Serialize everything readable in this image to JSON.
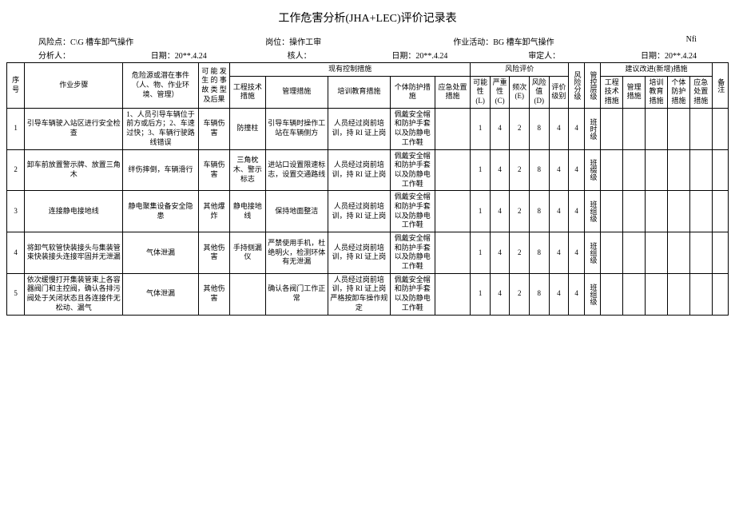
{
  "title": "工作危害分析(JHA+LEC)评价记录表",
  "meta": {
    "l1a": "风险点：C\\G 槽车卸气操作",
    "l1b": "岗位：操作工审",
    "l1c": "作业活动：BG 槽车卸气操作",
    "l1d": "Nfi",
    "l2a": "分析人：",
    "l2b": "日期：20**.4.24",
    "l2c": "核人：",
    "l2d": "日期：20**.4.24",
    "l2e": "审定人：",
    "l2f": "日期：20**.4.24"
  },
  "hdr": {
    "seq": "序号",
    "step": "作业步骤",
    "hazard": "危险源或潜在事件（人、物、作业环境、管理）",
    "acc": "可 能 发生 的 事故 类 型及后果",
    "ctrl": "现有控制措施",
    "eng": "工程技术措施",
    "mgt": "管理措施",
    "trn": "培训教育措施",
    "ppe": "个体防护措施",
    "emg": "应急处置措施",
    "risk": "风险评价",
    "l": "可能性(L)",
    "c": "严重性(C)",
    "e": "频次(E)",
    "d": "风险值(D)",
    "lv": "评价级别",
    "rl": "风险分级",
    "cl": "管控层级",
    "sug": "建议改进(新增)措施",
    "se": "工程技术措施",
    "sm": "管理措施",
    "st": "培训教育措施",
    "sp": "个体防护措施",
    "sa": "应急处置措施",
    "rm": "备注"
  },
  "rows": [
    {
      "n": "1",
      "step": "引导车辆驶入站区进行安全检查",
      "haz": "1、人员引导车辆位于前方或后方；2、车速过快；3、车辆行驶路线错误",
      "acc": "车辆伤害",
      "eng": "防撞柱",
      "mgt": "引导车辆时操作工站在车辆侧方",
      "trn": "人员经过岗前培训，持 RI 证上岗",
      "ppe": "佩戴安全帽和防护手套以及防静电工作鞋",
      "emg": "",
      "l": "1",
      "c": "4",
      "e": "2",
      "d": "8",
      "lv": "4",
      "rl": "4",
      "cl": "班时级"
    },
    {
      "n": "2",
      "step": "卸车前放置警示牌、放置三角木",
      "haz": "绊伤摔倒，车辆滑行",
      "acc": "车辆伤害",
      "eng": "三角枕木、警示标志",
      "mgt": "进站口设置限速标志，设置交通路线",
      "trn": "人员经过岗前培训，持 RI 证上岗",
      "ppe": "佩戴安全帽和防护手套以及防静电工作鞋",
      "emg": "",
      "l": "1",
      "c": "4",
      "e": "2",
      "d": "8",
      "lv": "4",
      "rl": "4",
      "cl": "班缀级"
    },
    {
      "n": "3",
      "step": "连接静电接地线",
      "haz": "静电聚集设备安全隐患",
      "acc": "其他爆炸",
      "eng": "静电接地线",
      "mgt": "保持地面整洁",
      "trn": "人员经过岗前培训，持 RI 证上岗",
      "ppe": "佩戴安全帽和防护手套以及防静电工作鞋",
      "emg": "",
      "l": "1",
      "c": "4",
      "e": "2",
      "d": "8",
      "lv": "4",
      "rl": "4",
      "cl": "班组级"
    },
    {
      "n": "4",
      "step": "将卸气软管快装接头与集装管束快装接头连接牢固并无泄漏",
      "haz": "气体泄漏",
      "acc": "其他伤害",
      "eng": "手持侧漏仪",
      "mgt": "严禁使用手机，杜绝明火，检测环体有无泄漏",
      "trn": "人员经过岗前培训，持 RI 证上岗",
      "ppe": "佩戴安全帽和防护手套以及防静电工作鞋",
      "emg": "",
      "l": "1",
      "c": "4",
      "e": "2",
      "d": "8",
      "lv": "4",
      "rl": "4",
      "cl": "班组级"
    },
    {
      "n": "5",
      "step": "依次缓慢打开集装管束上各容器阀门和主控阀，确认各排污阀处于关闭状态且各连接件无松动、漏气",
      "haz": "气体泄漏",
      "acc": "其他伤害",
      "eng": "",
      "mgt": "确认各阀门工作正常",
      "trn": "人员经过岗前培训，持 RI 证上岗 严格按卸车操作规定",
      "ppe": "佩戴安全帽和防护手套以及防静电工作鞋",
      "emg": "",
      "l": "1",
      "c": "4",
      "e": "2",
      "d": "8",
      "lv": "4",
      "rl": "4",
      "cl": "班组级"
    }
  ]
}
